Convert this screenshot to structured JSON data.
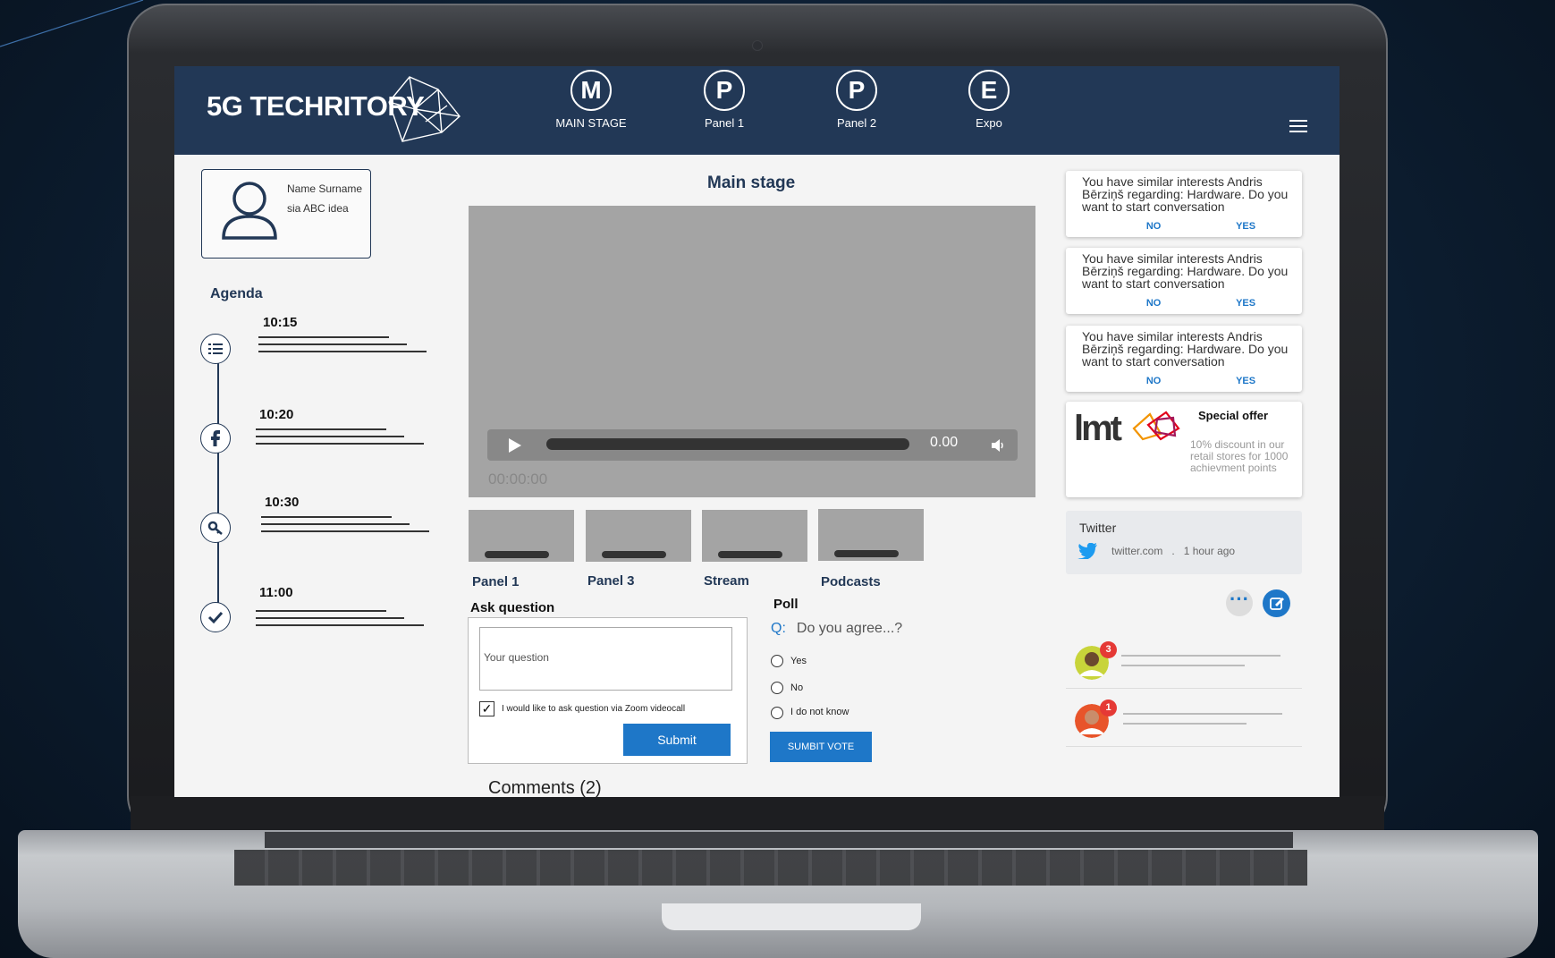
{
  "header": {
    "logo": "5G TECHRITORY",
    "nav": [
      {
        "letter": "M",
        "label": "MAIN STAGE"
      },
      {
        "letter": "P",
        "label": "Panel 1"
      },
      {
        "letter": "P",
        "label": "Panel 2"
      },
      {
        "letter": "E",
        "label": "Expo"
      }
    ]
  },
  "profile": {
    "name": "Name Surname",
    "company": "sia ABC idea"
  },
  "agenda": {
    "title": "Agenda",
    "items": [
      {
        "time": "10:15",
        "icon": "list-icon"
      },
      {
        "time": "10:20",
        "icon": "facebook-icon"
      },
      {
        "time": "10:30",
        "icon": "key-icon"
      },
      {
        "time": "11:00",
        "icon": "check-icon"
      }
    ]
  },
  "main": {
    "title": "Main stage",
    "player": {
      "duration": "0.00",
      "time": "00:00:00"
    },
    "thumbnails": [
      "Panel 1",
      "Panel 3",
      "Stream",
      "Podcasts"
    ]
  },
  "ask": {
    "title": "Ask question",
    "placeholder": "Your question",
    "checkbox_label": "I would like to ask question via Zoom videocall",
    "submit": "Submit"
  },
  "poll": {
    "title": "Poll",
    "q_prefix": "Q:",
    "question": "Do you agree...?",
    "options": [
      "Yes",
      "No",
      "I do not know"
    ],
    "vote": "SUMBIT VOTE"
  },
  "comments": "Comments (2)",
  "notifications": [
    {
      "text": "You have similar interests Andris Bērziņš regarding: Hardware. Do you want to start conversation",
      "no": "NO",
      "yes": "YES"
    },
    {
      "text": "You have similar interests Andris Bērziņš regarding: Hardware. Do you want to start conversation",
      "no": "NO",
      "yes": "YES"
    },
    {
      "text": "You have similar interests Andris Bērziņš regarding: Hardware. Do you want to start conversation",
      "no": "NO",
      "yes": "YES"
    }
  ],
  "offer": {
    "logo": "lmt",
    "title": "Special offer",
    "desc": "10% discount in our retail stores for 1000 achievment points"
  },
  "twitter": {
    "title": "Twitter",
    "source": "twitter.com",
    "sep": ".",
    "time": "1 hour ago"
  },
  "contacts": [
    {
      "badge": "3"
    },
    {
      "badge": "1"
    }
  ],
  "colors": {
    "header": "#223856",
    "accent": "#1e77c8",
    "badge": "#e53935"
  }
}
